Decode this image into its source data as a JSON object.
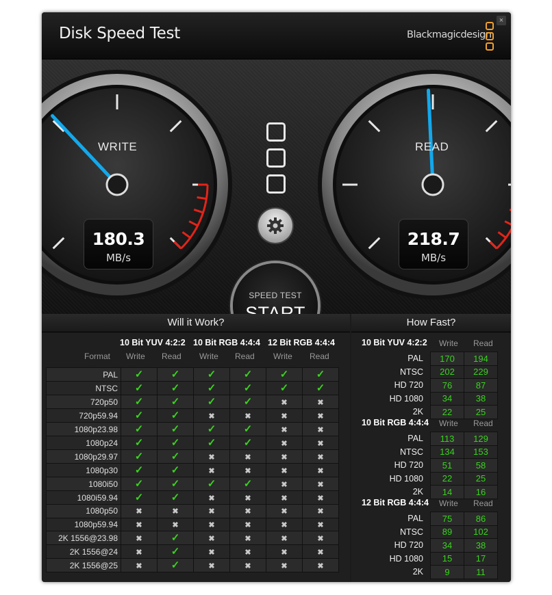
{
  "window": {
    "title": "Disk Speed Test",
    "brand": "Blackmagicdesign",
    "close_label": "×"
  },
  "gauges": {
    "write": {
      "label": "WRITE",
      "value": "180.3",
      "unit": "MB/s",
      "level": 0.34
    },
    "read": {
      "label": "READ",
      "value": "218.7",
      "unit": "MB/s",
      "level": 0.49
    },
    "start_small": "SPEED TEST",
    "start_big": "START"
  },
  "will_it_work": {
    "title": "Will it Work?",
    "format_label": "Format",
    "groups": [
      "10 Bit YUV 4:2:2",
      "10 Bit RGB 4:4:4",
      "12 Bit RGB 4:4:4"
    ],
    "write_label": "Write",
    "read_label": "Read",
    "check_glyph": "✓",
    "cross_glyph": "✖",
    "rows": [
      {
        "fmt": "PAL",
        "v": [
          1,
          1,
          1,
          1,
          1,
          1
        ]
      },
      {
        "fmt": "NTSC",
        "v": [
          1,
          1,
          1,
          1,
          1,
          1
        ]
      },
      {
        "fmt": "720p50",
        "v": [
          1,
          1,
          1,
          1,
          0,
          0
        ]
      },
      {
        "fmt": "720p59.94",
        "v": [
          1,
          1,
          0,
          0,
          0,
          0
        ]
      },
      {
        "fmt": "1080p23.98",
        "v": [
          1,
          1,
          1,
          1,
          0,
          0
        ]
      },
      {
        "fmt": "1080p24",
        "v": [
          1,
          1,
          1,
          1,
          0,
          0
        ]
      },
      {
        "fmt": "1080p29.97",
        "v": [
          1,
          1,
          0,
          0,
          0,
          0
        ]
      },
      {
        "fmt": "1080p30",
        "v": [
          1,
          1,
          0,
          0,
          0,
          0
        ]
      },
      {
        "fmt": "1080i50",
        "v": [
          1,
          1,
          1,
          1,
          0,
          0
        ]
      },
      {
        "fmt": "1080i59.94",
        "v": [
          1,
          1,
          0,
          0,
          0,
          0
        ]
      },
      {
        "fmt": "1080p50",
        "v": [
          0,
          0,
          0,
          0,
          0,
          0
        ]
      },
      {
        "fmt": "1080p59.94",
        "v": [
          0,
          0,
          0,
          0,
          0,
          0
        ]
      },
      {
        "fmt": "2K 1556@23.98",
        "v": [
          0,
          1,
          0,
          0,
          0,
          0
        ]
      },
      {
        "fmt": "2K 1556@24",
        "v": [
          0,
          1,
          0,
          0,
          0,
          0
        ]
      },
      {
        "fmt": "2K 1556@25",
        "v": [
          0,
          1,
          0,
          0,
          0,
          0
        ]
      }
    ]
  },
  "how_fast": {
    "title": "How Fast?",
    "write_label": "Write",
    "read_label": "Read",
    "groups": [
      {
        "name": "10 Bit YUV 4:2:2",
        "rows": [
          [
            "PAL",
            "170",
            "194"
          ],
          [
            "NTSC",
            "202",
            "229"
          ],
          [
            "HD 720",
            "76",
            "87"
          ],
          [
            "HD 1080",
            "34",
            "38"
          ],
          [
            "2K",
            "22",
            "25"
          ]
        ]
      },
      {
        "name": "10 Bit RGB 4:4:4",
        "rows": [
          [
            "PAL",
            "113",
            "129"
          ],
          [
            "NTSC",
            "134",
            "153"
          ],
          [
            "HD 720",
            "51",
            "58"
          ],
          [
            "HD 1080",
            "22",
            "25"
          ],
          [
            "2K",
            "14",
            "16"
          ]
        ]
      },
      {
        "name": "12 Bit RGB 4:4:4",
        "rows": [
          [
            "PAL",
            "75",
            "86"
          ],
          [
            "NTSC",
            "89",
            "102"
          ],
          [
            "HD 720",
            "34",
            "38"
          ],
          [
            "HD 1080",
            "15",
            "17"
          ],
          [
            "2K",
            "9",
            "11"
          ]
        ]
      }
    ]
  }
}
